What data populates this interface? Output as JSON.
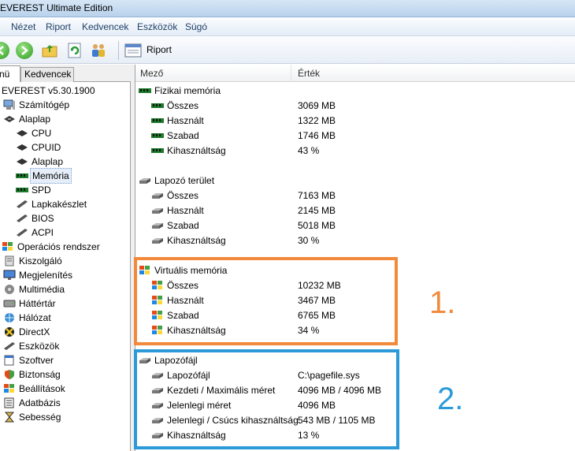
{
  "window": {
    "title": "EVEREST Ultimate Edition"
  },
  "menu": [
    "Nézet",
    "Riport",
    "Kedvencek",
    "Eszközök",
    "Súgó"
  ],
  "toolbar": {
    "report_label": "Riport"
  },
  "tabs": {
    "menu": "nü",
    "favorites": "Kedvencek"
  },
  "tree": {
    "root": "EVEREST v5.30.1900",
    "computer": "Számítógép",
    "motherboard": "Alaplap",
    "children": [
      "CPU",
      "CPUID",
      "Alaplap",
      "Memória",
      "SPD",
      "Lapkakészlet",
      "BIOS",
      "ACPI"
    ],
    "items": [
      "Operációs rendszer",
      "Kiszolgáló",
      "Megjelenítés",
      "Multimédia",
      "Háttértár",
      "Hálózat",
      "DirectX",
      "Eszközök",
      "Szoftver",
      "Biztonság",
      "Beállítások",
      "Adatbázis",
      "Sebesség"
    ]
  },
  "columns": {
    "field": "Mező",
    "value": "Érték"
  },
  "sections": [
    {
      "title": "Fizikai memória",
      "rows": [
        {
          "field": "Összes",
          "value": "3069 MB"
        },
        {
          "field": "Használt",
          "value": "1322 MB"
        },
        {
          "field": "Szabad",
          "value": "1746 MB"
        },
        {
          "field": "Kihasználtság",
          "value": "43 %"
        }
      ]
    },
    {
      "title": "Lapozó terület",
      "rows": [
        {
          "field": "Összes",
          "value": "7163 MB"
        },
        {
          "field": "Használt",
          "value": "2145 MB"
        },
        {
          "field": "Szabad",
          "value": "5018 MB"
        },
        {
          "field": "Kihasználtság",
          "value": "30 %"
        }
      ]
    },
    {
      "title": "Virtuális memória",
      "rows": [
        {
          "field": "Összes",
          "value": "10232 MB"
        },
        {
          "field": "Használt",
          "value": "3467 MB"
        },
        {
          "field": "Szabad",
          "value": "6765 MB"
        },
        {
          "field": "Kihasználtság",
          "value": "34 %"
        }
      ]
    },
    {
      "title": "Lapozófájl",
      "rows": [
        {
          "field": "Lapozófájl",
          "value": "C:\\pagefile.sys"
        },
        {
          "field": "Kezdeti / Maximális méret",
          "value": "4096 MB / 4096 MB"
        },
        {
          "field": "Jelenlegi méret",
          "value": "4096 MB"
        },
        {
          "field": "Jelenlegi / Csúcs kihasználtság",
          "value": "543 MB / 1105 MB"
        },
        {
          "field": "Kihasználtság",
          "value": "13 %"
        }
      ]
    }
  ],
  "annotations": {
    "first": "1.",
    "second": "2."
  },
  "colors": {
    "orange": "#f28a3c",
    "blue": "#2c9ad8"
  }
}
